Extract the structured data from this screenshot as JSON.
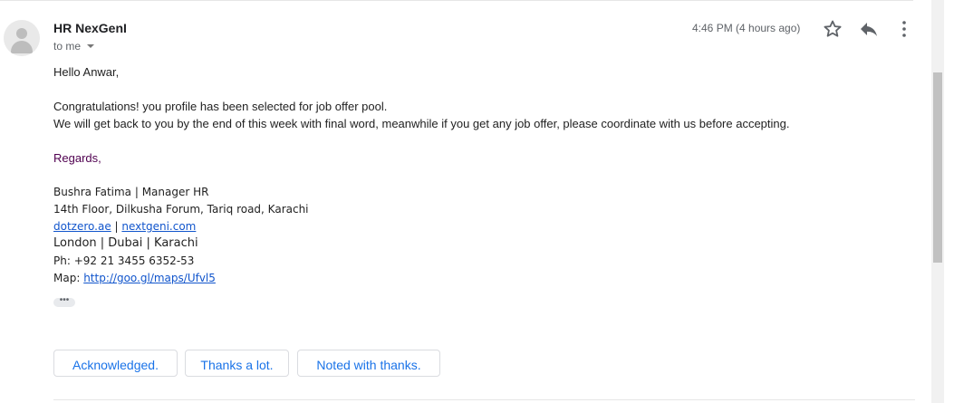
{
  "header": {
    "sender": "HR NexGenI",
    "recipient": "to me",
    "time": "4:46 PM (4 hours ago)"
  },
  "icons": {
    "avatar": "person-icon",
    "star": "star-icon",
    "reply": "reply-icon",
    "more": "more-vert-icon",
    "recipient_caret": "caret-down-icon"
  },
  "message": {
    "greeting": "Hello Anwar,",
    "line1": "Congratulations! you profile has been selected for job offer pool.",
    "line2": "We will get back to you by the end of this week with final word, meanwhile if you get any job offer, please coordinate with us before accepting.",
    "regards": "Regards,"
  },
  "signature": {
    "name_title": "Bushra Fatima | Manager HR",
    "address": "14th Floor, Dilkusha Forum, Tariq road, Karachi",
    "link1": "dotzero.ae",
    "separator": "|",
    "link2": "nextgeni.com",
    "cities": "London | Dubai | Karachi",
    "phone": "Ph: +92 21 3455 6352-53",
    "map_label": "Map:",
    "map_link": "http://goo.gl/maps/Ufvl5"
  },
  "trimmed_content": "•••",
  "smart_replies": [
    "Acknowledged.",
    "Thanks a lot.",
    "Noted with thanks."
  ],
  "colors": {
    "link": "#1155cc",
    "smart_reply_text": "#1a73e8",
    "regards": "#500050"
  }
}
